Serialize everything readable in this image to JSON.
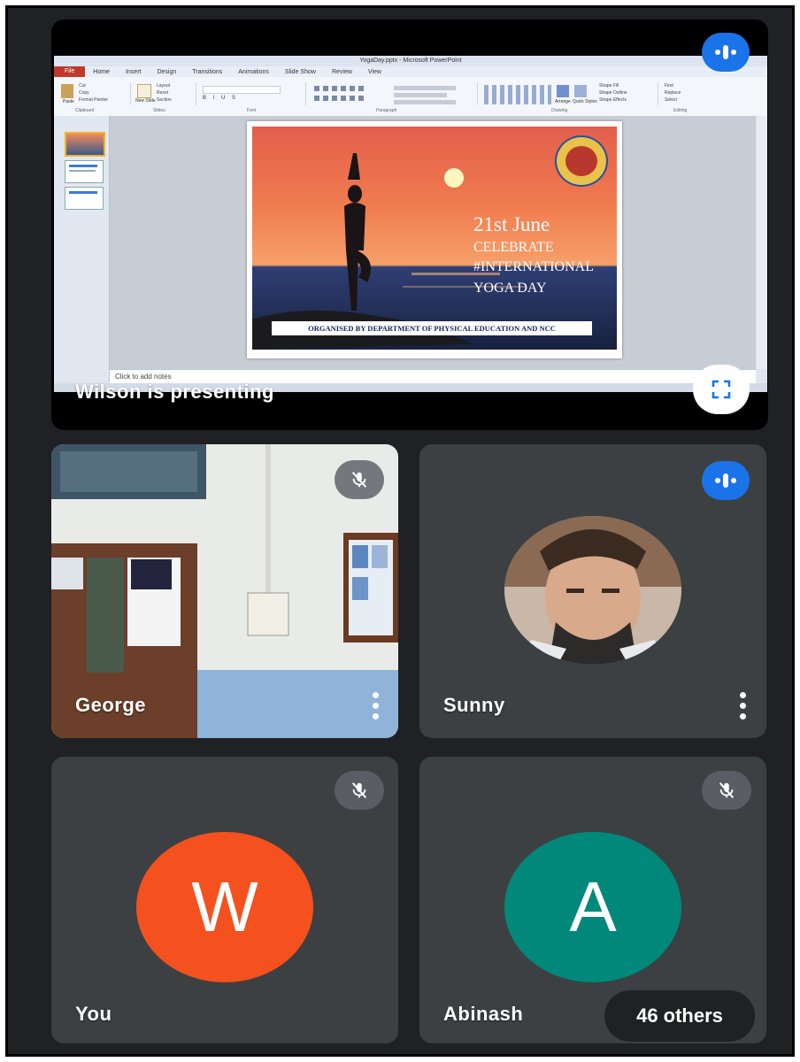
{
  "presentation": {
    "presenter_label": "Wilson is presenting",
    "ppt": {
      "window_title": "YogaDay.pptx - Microsoft PowerPoint",
      "file_tab": "File",
      "tabs": [
        "Home",
        "Insert",
        "Design",
        "Transitions",
        "Animations",
        "Slide Show",
        "Review",
        "View"
      ],
      "ribbon_groups": [
        "Clipboard",
        "Slides",
        "Font",
        "Paragraph",
        "Drawing",
        "Editing"
      ],
      "ribbon_buttons": [
        "Paste",
        "Cut",
        "Copy",
        "Format Painter",
        "New Slide",
        "Layout",
        "Reset",
        "Section",
        "Arrange",
        "Quick Styles",
        "Shape Fill",
        "Shape Outline",
        "Shape Effects",
        "Find",
        "Replace",
        "Select"
      ],
      "notes_placeholder": "Click to add notes"
    },
    "slide": {
      "date": "21st June",
      "line1": "CELEBRATE",
      "line2": "#INTERNATIONAL",
      "line3": "YOGA DAY",
      "banner": "ORGANISED BY DEPARTMENT OF PHYSICAL EDUCATION AND NCC"
    }
  },
  "participants": [
    {
      "name": "George",
      "muted": true
    },
    {
      "name": "Sunny",
      "speaking": true
    },
    {
      "name": "You",
      "initial": "W",
      "avatar_color": "#f4511e",
      "muted": true
    },
    {
      "name": "Abinash",
      "initial": "A",
      "avatar_color": "#00897b",
      "muted": true
    }
  ],
  "others_label": "46 others",
  "colors": {
    "background": "#202124",
    "tile": "#3c4043",
    "accent": "#1a73e8"
  }
}
